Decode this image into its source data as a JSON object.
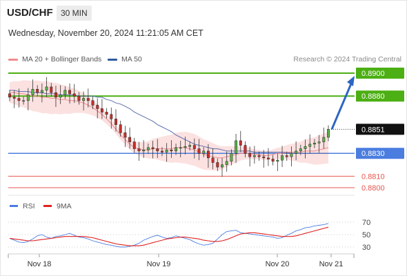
{
  "header": {
    "symbol": "USD/CHF",
    "timeframe": "30 MIN",
    "datetime": "Wednesday, November 20, 2024 11:21:05 AM CET"
  },
  "legend": {
    "ma20": {
      "label": "MA 20 + Bollinger Bands",
      "color": "#f08c8c"
    },
    "ma50": {
      "label": "MA 50",
      "color": "#2f5a9e"
    },
    "credit": "Research © 2024 Trading Central"
  },
  "chart_data": [
    {
      "type": "candlestick",
      "ylim": [
        0.8797,
        0.8907
      ],
      "levels": [
        {
          "value": "0.8900",
          "y": 0.89,
          "kind": "target",
          "color": "#4caf13"
        },
        {
          "value": "0.8880",
          "y": 0.888,
          "kind": "resistance",
          "color": "#4caf13"
        },
        {
          "value": "0.8851",
          "y": 0.8851,
          "kind": "last",
          "color": "#111111"
        },
        {
          "value": "0.8830",
          "y": 0.883,
          "kind": "pivot",
          "color": "#4a7ddf"
        },
        {
          "value": "0.8810",
          "y": 0.881,
          "kind": "support",
          "color": "#e8544f"
        },
        {
          "value": "0.8800",
          "y": 0.88,
          "kind": "support",
          "color": "#e8544f"
        }
      ],
      "x_ticks": [
        "Nov 18",
        "Nov 19",
        "Nov 20",
        "Nov 21"
      ],
      "series": [
        {
          "name": "MA 50",
          "values": [
            0.8885,
            0.8885,
            0.8884,
            0.8884,
            0.8884,
            0.8883,
            0.8883,
            0.8883,
            0.8882,
            0.8882,
            0.8882,
            0.8881,
            0.8881,
            0.8881,
            0.8881,
            0.888,
            0.888,
            0.888,
            0.888,
            0.8879,
            0.8879,
            0.8877,
            0.8876,
            0.8874,
            0.8873,
            0.8871,
            0.8869,
            0.8866,
            0.8864,
            0.8862,
            0.886,
            0.8858,
            0.8855,
            0.8853,
            0.8851,
            0.8849,
            0.8846,
            0.8844,
            0.8842,
            0.884,
            0.8838,
            0.8837,
            0.8836,
            0.8835,
            0.8834,
            0.8834,
            0.8833,
            0.8832,
            0.8832,
            0.8832,
            0.8832,
            0.8832,
            0.8832,
            0.8831,
            0.8831,
            0.8831,
            0.8831,
            0.8831,
            0.8831,
            0.8831,
            0.8831,
            0.883,
            0.883,
            0.883,
            0.883,
            0.883,
            0.883,
            0.883,
            0.883,
            0.883
          ]
        },
        {
          "name": "MA 20",
          "values": [
            0.8883,
            0.8883,
            0.8882,
            0.8882,
            0.8881,
            0.888,
            0.888,
            0.8879,
            0.8879,
            0.8878,
            0.8878,
            0.8877,
            0.8877,
            0.8876,
            0.8876,
            0.8875,
            0.8874,
            0.8872,
            0.887,
            0.8867,
            0.8864,
            0.886,
            0.8856,
            0.8851,
            0.8846,
            0.8842,
            0.8838,
            0.8835,
            0.8834,
            0.8833,
            0.8833,
            0.8834,
            0.8834,
            0.8834,
            0.8834,
            0.8834,
            0.8835,
            0.8835,
            0.8835,
            0.8834,
            0.8833,
            0.8831,
            0.8829,
            0.8828,
            0.8827,
            0.8826,
            0.8826,
            0.8827,
            0.8828,
            0.8829,
            0.883,
            0.883,
            0.883,
            0.8829,
            0.8829,
            0.8828,
            0.8828,
            0.8829,
            0.883,
            0.883,
            0.8831,
            0.8831,
            0.8831,
            0.8831,
            0.8832,
            0.8832,
            0.8832,
            0.8833,
            0.8834,
            0.8835
          ]
        }
      ],
      "candles_close": [
        0.8879,
        0.8878,
        0.8876,
        0.8876,
        0.8881,
        0.8886,
        0.8883,
        0.8885,
        0.8888,
        0.8883,
        0.8879,
        0.8881,
        0.8885,
        0.8882,
        0.888,
        0.8876,
        0.8878,
        0.8876,
        0.8872,
        0.8869,
        0.8866,
        0.8864,
        0.886,
        0.8855,
        0.8848,
        0.8844,
        0.884,
        0.8834,
        0.8832,
        0.8833,
        0.8835,
        0.8834,
        0.8832,
        0.8831,
        0.8833,
        0.8832,
        0.8835,
        0.8835,
        0.8836,
        0.8837,
        0.8834,
        0.883,
        0.8832,
        0.8826,
        0.8822,
        0.8818,
        0.882,
        0.8823,
        0.883,
        0.8841,
        0.8837,
        0.883,
        0.8827,
        0.8828,
        0.8827,
        0.8826,
        0.8825,
        0.8823,
        0.8824,
        0.8828,
        0.8827,
        0.883,
        0.8832,
        0.8834,
        0.8836,
        0.8838,
        0.8839,
        0.884,
        0.8844,
        0.8851
      ],
      "forecast": {
        "from": 0.8851,
        "to": 0.89
      }
    },
    {
      "type": "line",
      "yticks": [
        "70",
        "50",
        "30"
      ],
      "ylim": [
        20,
        80
      ],
      "series": [
        {
          "name": "RSI",
          "color": "#4a7ddf",
          "values": [
            44,
            41,
            38,
            37,
            39,
            43,
            48,
            50,
            46,
            44,
            47,
            48,
            50,
            52,
            49,
            46,
            45,
            43,
            40,
            38,
            36,
            34,
            33,
            31,
            30,
            30,
            31,
            33,
            36,
            41,
            44,
            47,
            49,
            46,
            44,
            45,
            48,
            46,
            44,
            42,
            38,
            35,
            33,
            34,
            36,
            43,
            50,
            55,
            56,
            57,
            53,
            52,
            51,
            50,
            49,
            48,
            47,
            46,
            44,
            45,
            49,
            52,
            56,
            58,
            61,
            62,
            64,
            65,
            66,
            68
          ]
        },
        {
          "name": "9MA",
          "color": "#e02020",
          "values": [
            44,
            43,
            42,
            41,
            40,
            40,
            41,
            42,
            43,
            44,
            45,
            46,
            47,
            47,
            47,
            47,
            47,
            46,
            45,
            43,
            41,
            39,
            37,
            35,
            34,
            33,
            32,
            32,
            32,
            33,
            35,
            37,
            39,
            41,
            43,
            44,
            45,
            46,
            46,
            45,
            44,
            43,
            41,
            40,
            39,
            39,
            40,
            42,
            45,
            48,
            51,
            52,
            53,
            53,
            52,
            51,
            50,
            49,
            48,
            47,
            47,
            47,
            48,
            50,
            52,
            54,
            56,
            58,
            60,
            62
          ]
        }
      ]
    }
  ]
}
